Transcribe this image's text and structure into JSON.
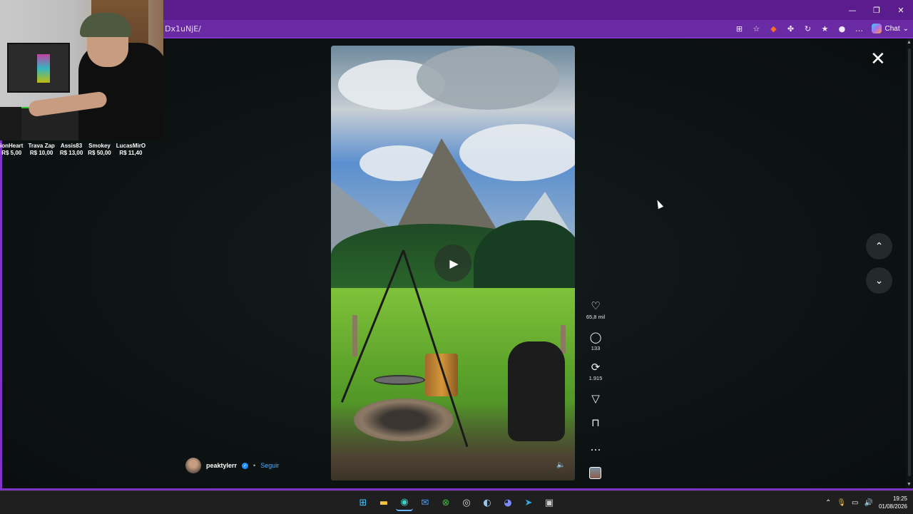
{
  "browser": {
    "url_fragment": "Dx1uNjE/",
    "chat_label": "Chat",
    "window_controls": [
      "minimize-icon",
      "restore-icon",
      "close-icon"
    ],
    "toolbar_icons": [
      "app-available-icon",
      "favorite-star-icon",
      "extension-fox-icon",
      "extensions-puzzle-icon",
      "history-icon",
      "favorites-icon",
      "profile-icon",
      "more-icon"
    ]
  },
  "stream_overlay": {
    "donations": [
      {
        "name": "ionHeart",
        "amount": "R$ 5,00"
      },
      {
        "name": "Trava Zap",
        "amount": "R$ 10,00"
      },
      {
        "name": "Assis83",
        "amount": "R$ 13,00"
      },
      {
        "name": "Smokey",
        "amount": "R$ 50,00"
      },
      {
        "name": "LucasMirO",
        "amount": "R$ 11,40"
      }
    ]
  },
  "post": {
    "username": "peaktylerr",
    "separator": "•",
    "follow_label": "Seguir",
    "likes": "65,8 mil",
    "comments": "133",
    "reposts": "1.915"
  },
  "taskbar": {
    "time": "19:25",
    "date": "01/08/2026",
    "apps": [
      "windows-start-icon",
      "file-explorer-icon",
      "edge-browser-icon",
      "mail-icon",
      "xbox-icon",
      "github-icon",
      "steam-icon",
      "discord-icon",
      "telegram-icon",
      "game-icon"
    ]
  },
  "colors": {
    "browser_accent": "#5b1c8e",
    "verified": "#1e90ff",
    "follow_link": "#4fa8ff"
  }
}
